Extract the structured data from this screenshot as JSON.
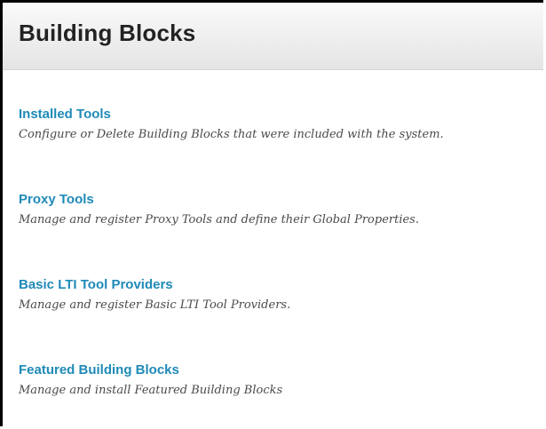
{
  "header": {
    "title": "Building Blocks"
  },
  "tools": [
    {
      "label": "Installed Tools",
      "description": "Configure or Delete Building Blocks that were included with the system."
    },
    {
      "label": "Proxy Tools",
      "description": "Manage and register Proxy Tools and define their Global Properties."
    },
    {
      "label": "Basic LTI Tool Providers",
      "description": "Manage and register Basic LTI Tool Providers."
    },
    {
      "label": "Featured Building Blocks",
      "description": "Manage and install Featured Building Blocks"
    }
  ],
  "colors": {
    "link": "#1f8ab7",
    "title": "#222222",
    "description": "#4a4a4a",
    "header_bg": "#ededed"
  }
}
